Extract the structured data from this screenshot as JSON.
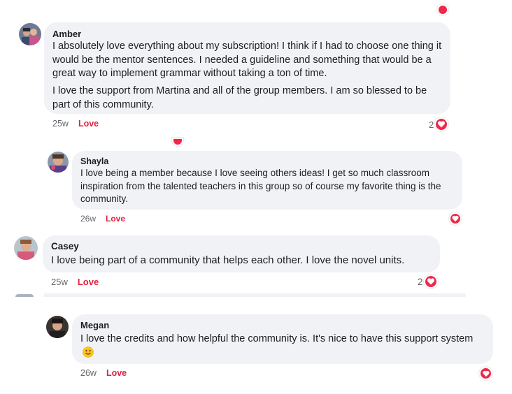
{
  "comments": [
    {
      "author": "Amber",
      "paragraphs": [
        "I absolutely love everything about my subscription! I think if I had to choose one thing it would be the mentor sentences. I needed a guideline and something that would be a great way to implement grammar without taking a ton of time.",
        "I love the support from Martina and all of the group members. I am so blessed to be part of this community."
      ],
      "time": "25w",
      "action": "Love",
      "reaction_count": "2"
    },
    {
      "author": "Shayla",
      "paragraphs": [
        "I love being a member because I love seeing others ideas! I get so much classroom inspiration from the talented teachers in this group so of course my favorite thing is the community."
      ],
      "time": "26w",
      "action": "Love",
      "reaction_count": ""
    },
    {
      "author": "Casey",
      "paragraphs": [
        "I love being part of a community that helps each other. I love the novel units."
      ],
      "time": "25w",
      "action": "Love",
      "reaction_count": "2"
    },
    {
      "author": "Megan",
      "paragraphs": [
        "I love the credits and how helpful the community is. It's nice to have this support system"
      ],
      "emoji": "🙂",
      "time": "26w",
      "action": "Love",
      "reaction_count": ""
    }
  ],
  "colors": {
    "bubble": "#f0f2f5",
    "love_text": "#e41e3f",
    "heart": "#f02849",
    "meta_text": "#65676b"
  },
  "icons": [
    "heart-reaction-icon",
    "smile-emoji-icon"
  ]
}
